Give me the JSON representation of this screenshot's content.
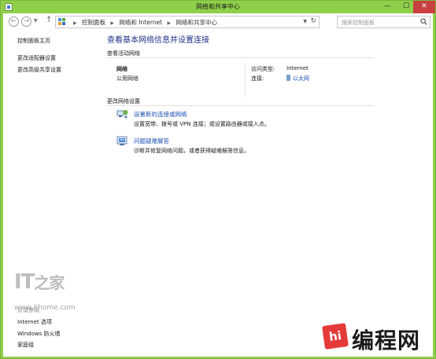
{
  "window": {
    "title": "网络和共享中心",
    "minimize_glyph": "—",
    "maximize_glyph": "☐",
    "close_glyph": "✕"
  },
  "navbar": {
    "back_glyph": "←",
    "forward_glyph": "→",
    "up_glyph": "↑",
    "breadcrumbs": [
      "控制面板",
      "网络和 Internet",
      "网络和共享中心"
    ],
    "search_placeholder": "搜索控制面板"
  },
  "sidebar": {
    "items": [
      {
        "label": "控制面板主页"
      },
      {
        "label": "更改适配器设置"
      },
      {
        "label": "更改高级共享设置"
      }
    ],
    "see_also_title": "另请参阅",
    "see_also": [
      {
        "label": "Internet 选项"
      },
      {
        "label": "Windows 防火墙"
      },
      {
        "label": "家庭组"
      }
    ]
  },
  "watermark": {
    "logo": "IT之家",
    "url": "www.ithome.com"
  },
  "main": {
    "title": "查看基本网络信息并设置连接",
    "active_networks_heading": "查看活动网络",
    "network": {
      "name": "网络",
      "type": "公用网络",
      "access_type_label": "访问类型:",
      "access_type_value": "Internet",
      "connections_label": "连接:",
      "connections_value": "以太网"
    },
    "change_settings_heading": "更改网络设置",
    "tasks": [
      {
        "icon": "network-setup-icon",
        "link": "设置新的连接或网络",
        "desc": "设置宽带、拨号或 VPN 连接；或设置路由器或接入点。"
      },
      {
        "icon": "troubleshoot-icon",
        "link": "问题疑难解答",
        "desc": "诊断并修复网络问题，或者获得疑难解答信息。"
      }
    ]
  },
  "brand": {
    "badge": "hi",
    "text": "编程网"
  },
  "colors": {
    "titlebar": "#8fd04a",
    "link": "#1e50b4",
    "title": "#1e3287",
    "close": "#c94040"
  }
}
